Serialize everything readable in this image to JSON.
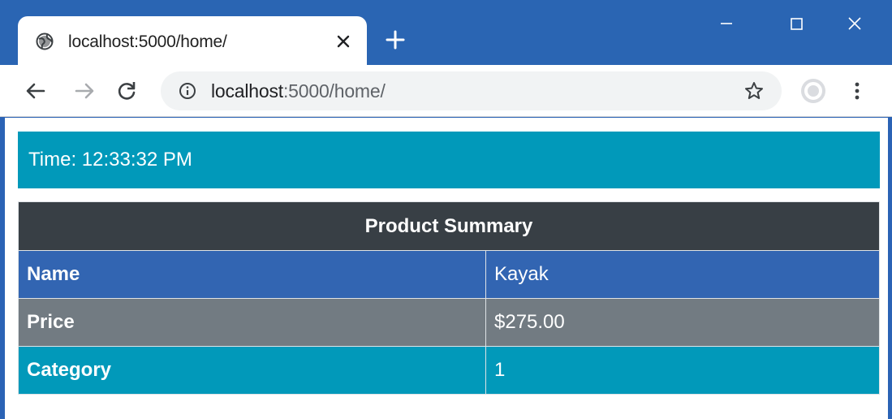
{
  "browser": {
    "tab_title": "localhost:5000/home/",
    "url_host": "localhost",
    "url_rest": ":5000/home/",
    "colors": {
      "titlebar": "#2a65b3",
      "toolbar": "#ffffff",
      "omnibox": "#f1f3f4"
    }
  },
  "page": {
    "time_text": "Time: 12:33:32 PM",
    "table": {
      "header": "Product Summary",
      "rows": [
        {
          "label": "Name",
          "value": "Kayak",
          "color": "#3265b2"
        },
        {
          "label": "Price",
          "value": "$275.00",
          "color": "#727b82"
        },
        {
          "label": "Category",
          "value": "1",
          "color": "#0199ba"
        }
      ]
    },
    "colors": {
      "time_bar": "#0199ba",
      "table_header": "#383f45"
    }
  }
}
